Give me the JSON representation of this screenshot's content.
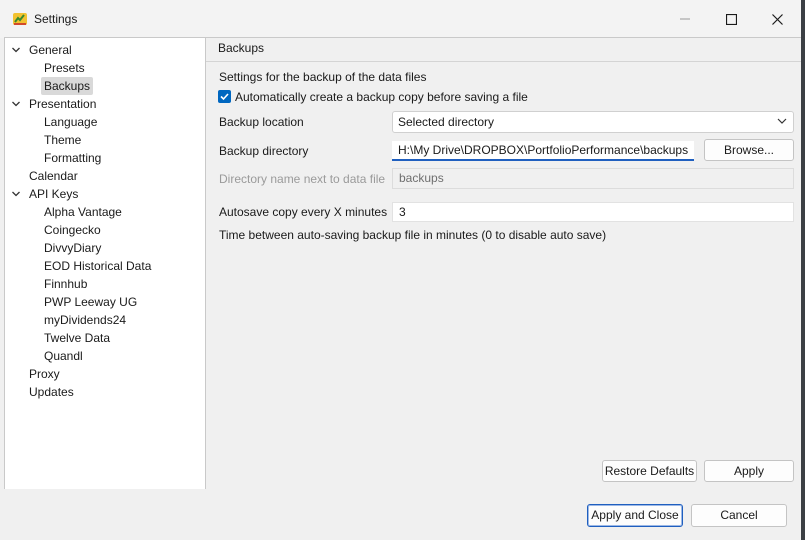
{
  "window": {
    "title": "Settings",
    "minimize_label": "Minimize",
    "maximize_label": "Maximize",
    "close_label": "Close"
  },
  "tree": [
    {
      "label": "General",
      "level": 0,
      "expanded": true
    },
    {
      "label": "Presets",
      "level": 1
    },
    {
      "label": "Backups",
      "level": 1,
      "selected": true
    },
    {
      "label": "Presentation",
      "level": 0,
      "expanded": true
    },
    {
      "label": "Language",
      "level": 1
    },
    {
      "label": "Theme",
      "level": 1
    },
    {
      "label": "Formatting",
      "level": 1
    },
    {
      "label": "Calendar",
      "level": 0
    },
    {
      "label": "API Keys",
      "level": 0,
      "expanded": true
    },
    {
      "label": "Alpha Vantage",
      "level": 1
    },
    {
      "label": "Coingecko",
      "level": 1
    },
    {
      "label": "DivvyDiary",
      "level": 1
    },
    {
      "label": "EOD Historical Data",
      "level": 1
    },
    {
      "label": "Finnhub",
      "level": 1
    },
    {
      "label": "PWP Leeway UG",
      "level": 1
    },
    {
      "label": "myDividends24",
      "level": 1
    },
    {
      "label": "Twelve Data",
      "level": 1
    },
    {
      "label": "Quandl",
      "level": 1
    },
    {
      "label": "Proxy",
      "level": 0
    },
    {
      "label": "Updates",
      "level": 0
    }
  ],
  "page": {
    "title": "Backups",
    "description": "Settings for the backup of the data files",
    "auto_backup_label": "Automatically create a backup copy before saving a file",
    "auto_backup_checked": true,
    "backup_location_label": "Backup location",
    "backup_location_value": "Selected directory",
    "backup_directory_label": "Backup directory",
    "backup_directory_value": "H:\\My Drive\\DROPBOX\\PortfolioPerformance\\backups",
    "browse_label": "Browse...",
    "dirname_label": "Directory name next to data file",
    "dirname_value": "backups",
    "autosave_label": "Autosave copy every X minutes",
    "autosave_value": "3",
    "autosave_help": "Time between auto-saving backup file in minutes (0 to disable auto save)",
    "restore_defaults_label": "Restore Defaults",
    "apply_label": "Apply"
  },
  "footer": {
    "apply_close_label": "Apply and Close",
    "cancel_label": "Cancel"
  },
  "colors": {
    "accent": "#0067c0",
    "focus_underline": "#1f5fbf"
  }
}
